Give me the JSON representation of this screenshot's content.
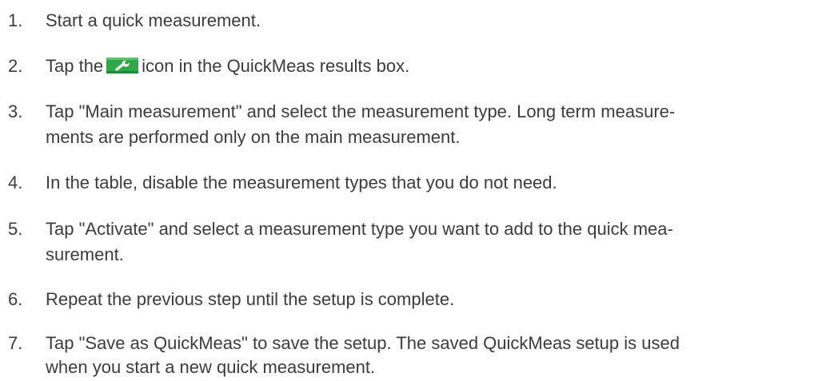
{
  "steps": [
    {
      "number": "1.",
      "lines": [
        "Start a quick measurement."
      ]
    },
    {
      "number": "2.",
      "before_icon": "Tap the",
      "icon": "wrench-settings-icon",
      "icon_color": "#2fa84a",
      "after_icon": "icon in the QuickMeas results box."
    },
    {
      "number": "3.",
      "lines": [
        "Tap \"Main measurement\" and select the measurement type. Long term measure-",
        "ments are performed only on the main measurement."
      ]
    },
    {
      "number": "4.",
      "lines": [
        "In the table, disable the measurement types that you do not need."
      ]
    },
    {
      "number": "5.",
      "lines": [
        "Tap \"Activate\" and select a measurement type you want to add to the quick mea-",
        "surement."
      ]
    },
    {
      "number": "6.",
      "lines": [
        "Repeat the previous step until the setup is complete."
      ]
    },
    {
      "number": "7.",
      "lines": [
        "Tap \"Save as QuickMeas\" to save the setup. The saved QuickMeas setup is used",
        "when you start a new quick measurement."
      ]
    }
  ]
}
